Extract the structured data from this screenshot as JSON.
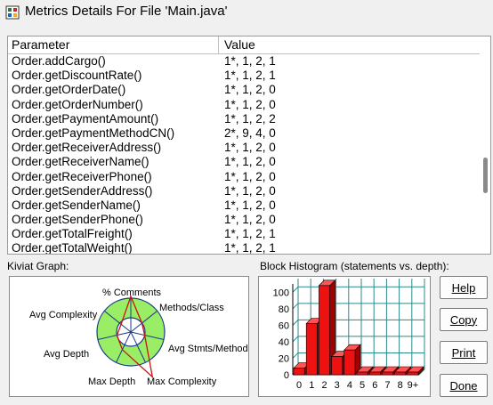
{
  "window": {
    "title": "Metrics Details For File 'Main.java'",
    "icon": "metrics-app-icon"
  },
  "table": {
    "headers": {
      "parameter": "Parameter",
      "value": "Value"
    },
    "rows": [
      {
        "param": "Order.addCargo()",
        "value": "1*, 1, 2, 1"
      },
      {
        "param": "Order.getDiscountRate()",
        "value": "1*, 1, 2, 1"
      },
      {
        "param": "Order.getOrderDate()",
        "value": "1*, 1, 2, 0"
      },
      {
        "param": "Order.getOrderNumber()",
        "value": "1*, 1, 2, 0"
      },
      {
        "param": "Order.getPaymentAmount()",
        "value": "1*, 1, 2, 2"
      },
      {
        "param": "Order.getPaymentMethodCN()",
        "value": "2*, 9, 4, 0"
      },
      {
        "param": "Order.getReceiverAddress()",
        "value": "1*, 1, 2, 0"
      },
      {
        "param": "Order.getReceiverName()",
        "value": "1*, 1, 2, 0"
      },
      {
        "param": "Order.getReceiverPhone()",
        "value": "1*, 1, 2, 0"
      },
      {
        "param": "Order.getSenderAddress()",
        "value": "1*, 1, 2, 0"
      },
      {
        "param": "Order.getSenderName()",
        "value": "1*, 1, 2, 0"
      },
      {
        "param": "Order.getSenderPhone()",
        "value": "1*, 1, 2, 0"
      },
      {
        "param": "Order.getTotalFreight()",
        "value": "1*, 1, 2, 1"
      },
      {
        "param": "Order.getTotalWeight()",
        "value": "1*, 1, 2, 1"
      }
    ]
  },
  "kiviat": {
    "label": "Kiviat Graph:",
    "axes": [
      "% Comments",
      "Methods/Class",
      "Avg Stmts/Method",
      "Max Complexity",
      "Max Depth",
      "Avg Depth",
      "Avg Complexity"
    ],
    "colors": {
      "ring": "#99ee66",
      "outline": "#1a3a8a",
      "line": "#cc1111"
    }
  },
  "histogram": {
    "label": "Block Histogram (statements vs. depth):",
    "colors": {
      "bar": "#ee1111",
      "grid": "#2a8a8a"
    }
  },
  "chart_data": {
    "type": "bar",
    "categories": [
      "0",
      "1",
      "2",
      "3",
      "4",
      "5",
      "6",
      "7",
      "8",
      "9+"
    ],
    "values": [
      8,
      62,
      108,
      22,
      30,
      0,
      0,
      0,
      0,
      0
    ],
    "ylim": [
      0,
      110
    ],
    "yticks": [
      "0",
      "20",
      "40",
      "60",
      "80",
      "100"
    ],
    "title": "Block Histogram (statements vs. depth):",
    "xlabel": "",
    "ylabel": ""
  },
  "buttons": {
    "help": {
      "label": "Help",
      "icon": "help"
    },
    "copy": {
      "label": "Copy",
      "icon": "copy"
    },
    "print": {
      "label": "Print",
      "icon": "print"
    },
    "done": {
      "label": "Done",
      "icon": "done"
    }
  }
}
